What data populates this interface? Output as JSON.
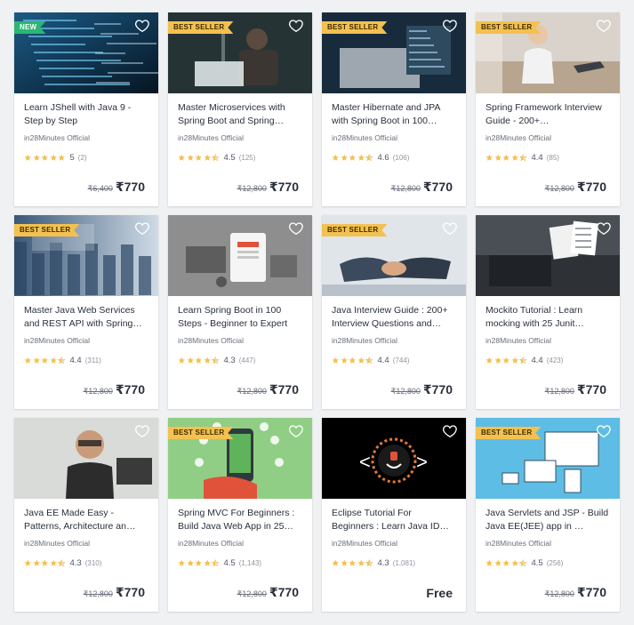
{
  "colors": {
    "background": "#f0f1f3",
    "best_seller_badge": "#f4c150",
    "new_badge": "#2bb673",
    "star": "#f4c150",
    "text_dark": "#29303b",
    "text_muted": "#686f7a"
  },
  "courses": [
    {
      "badge": "NEW",
      "badge_type": "new",
      "title": "Learn JShell with Java 9 - Step by Step",
      "author": "in28Minutes Official",
      "rating": "5",
      "rating_value": 5.0,
      "reviews": "(2)",
      "original_price": "₹6,400",
      "price": "₹770",
      "thumb": "code-blue"
    },
    {
      "badge": "BEST SELLER",
      "badge_type": "best",
      "title": "Master Microservices with Spring Boot and Spring…",
      "author": "in28Minutes Official",
      "rating": "4.5",
      "rating_value": 4.5,
      "reviews": "(125)",
      "original_price": "₹12,800",
      "price": "₹770",
      "thumb": "man-laptop"
    },
    {
      "badge": "BEST SELLER",
      "badge_type": "best",
      "title": "Master Hibernate and JPA with Spring Boot in 100…",
      "author": "in28Minutes Official",
      "rating": "4.6",
      "rating_value": 4.6,
      "reviews": "(106)",
      "original_price": "₹12,800",
      "price": "₹770",
      "thumb": "laptop-dark"
    },
    {
      "badge": "BEST SELLER",
      "badge_type": "best",
      "title": "Spring Framework Interview Guide - 200+…",
      "author": "in28Minutes Official",
      "rating": "4.4",
      "rating_value": 4.4,
      "reviews": "(85)",
      "original_price": "₹12,800",
      "price": "₹770",
      "thumb": "handshake-office"
    },
    {
      "badge": "BEST SELLER",
      "badge_type": "best",
      "title": "Master Java Web Services and REST API with Spring…",
      "author": "in28Minutes Official",
      "rating": "4.4",
      "rating_value": 4.4,
      "reviews": "(311)",
      "original_price": "₹12,800",
      "price": "₹770",
      "thumb": "city-tech"
    },
    {
      "badge": "",
      "badge_type": "none",
      "title": "Learn Spring Boot in 100 Steps - Beginner to Expert",
      "author": "in28Minutes Official",
      "rating": "4.3",
      "rating_value": 4.3,
      "reviews": "(447)",
      "original_price": "₹12,800",
      "price": "₹770",
      "thumb": "gray-devices"
    },
    {
      "badge": "BEST SELLER",
      "badge_type": "best",
      "title": "Java Interview Guide : 200+ Interview Questions and…",
      "author": "in28Minutes Official",
      "rating": "4.4",
      "rating_value": 4.4,
      "reviews": "(744)",
      "original_price": "₹12,800",
      "price": "₹770",
      "thumb": "handshake"
    },
    {
      "badge": "",
      "badge_type": "none",
      "title": "Mockito Tutorial : Learn mocking with 25 Junit…",
      "author": "in28Minutes Official",
      "rating": "4.4",
      "rating_value": 4.4,
      "reviews": "(423)",
      "original_price": "₹12,800",
      "price": "₹770",
      "thumb": "laptop-docs"
    },
    {
      "badge": "",
      "badge_type": "none",
      "title": "Java EE Made Easy - Patterns, Architecture an…",
      "author": "in28Minutes Official",
      "rating": "4.3",
      "rating_value": 4.3,
      "reviews": "(310)",
      "original_price": "₹12,800",
      "price": "₹770",
      "thumb": "man-glasses"
    },
    {
      "badge": "BEST SELLER",
      "badge_type": "best",
      "title": "Spring MVC For Beginners : Build Java Web App in 25…",
      "author": "in28Minutes Official",
      "rating": "4.5",
      "rating_value": 4.5,
      "reviews": "(1,143)",
      "original_price": "₹12,800",
      "price": "₹770",
      "thumb": "phone-hand"
    },
    {
      "badge": "",
      "badge_type": "none",
      "title": "Eclipse Tutorial For Beginners : Learn Java ID…",
      "author": "in28Minutes Official",
      "rating": "4.3",
      "rating_value": 4.3,
      "reviews": "(1,081)",
      "original_price": "",
      "price": "Free",
      "thumb": "java-logo"
    },
    {
      "badge": "BEST SELLER",
      "badge_type": "best",
      "title": "Java Servlets and JSP - Build Java EE(JEE) app in …",
      "author": "in28Minutes Official",
      "rating": "4.5",
      "rating_value": 4.5,
      "reviews": "(256)",
      "original_price": "₹12,800",
      "price": "₹770",
      "thumb": "devices-blue"
    }
  ]
}
